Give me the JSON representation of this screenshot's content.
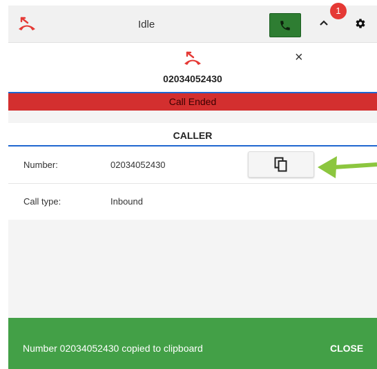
{
  "topbar": {
    "status": "Idle",
    "notification_count": "1",
    "colors": {
      "hangup": "#e53935",
      "call_button": "#2e7d32"
    }
  },
  "call": {
    "close_symbol": "×",
    "number": "02034052430",
    "status_banner": "Call Ended"
  },
  "caller": {
    "section_title": "CALLER",
    "rows": [
      {
        "label": "Number:",
        "value": "02034052430"
      },
      {
        "label": "Call type:",
        "value": "Inbound"
      }
    ]
  },
  "snackbar": {
    "message": "Number 02034052430 copied to clipboard",
    "action": "CLOSE"
  },
  "icons": [
    "hangup-icon",
    "phone-icon",
    "chevron-up-icon",
    "settings-icon",
    "call-ended-icon",
    "close-icon",
    "copy-icon",
    "arrow-icon"
  ]
}
